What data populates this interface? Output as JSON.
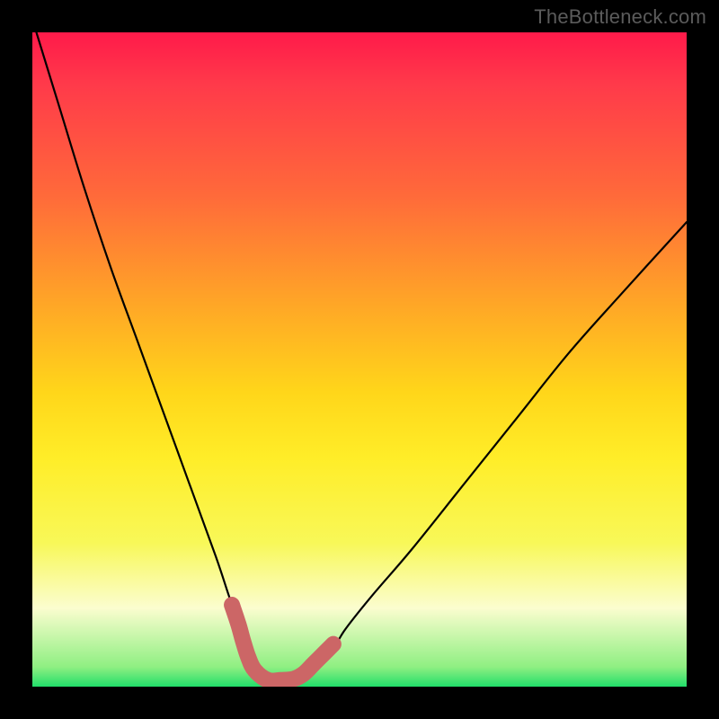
{
  "watermark": {
    "text": "TheBottleneck.com"
  },
  "chart_data": {
    "type": "line",
    "title": "",
    "xlabel": "",
    "ylabel": "",
    "xlim": [
      0,
      100
    ],
    "ylim": [
      0,
      100
    ],
    "series": [
      {
        "name": "bottleneck-curve",
        "x": [
          0,
          4,
          8,
          12,
          16,
          20,
          24,
          28,
          30,
          32,
          33,
          34,
          35,
          36,
          37,
          38,
          39,
          42,
          46,
          48,
          52,
          58,
          66,
          74,
          82,
          90,
          100
        ],
        "values": [
          102,
          89,
          76,
          64,
          53,
          42,
          31,
          20,
          14,
          8,
          5,
          3,
          2,
          1,
          1,
          1,
          1,
          1.5,
          6,
          9,
          14,
          21,
          31,
          41,
          51,
          60,
          71
        ]
      }
    ],
    "highlight": {
      "x": [
        30.5,
        31.5,
        32.2,
        33.0,
        34.0,
        36.0,
        38.0,
        40.0,
        41.5,
        43.0,
        44.5,
        46.0
      ],
      "values": [
        12.5,
        9.5,
        7.0,
        4.5,
        2.5,
        1.0,
        1.0,
        1.2,
        2.0,
        3.5,
        5.0,
        6.5
      ]
    },
    "gradient_stops": [
      {
        "pos": 0.0,
        "color": "#ff1a4a"
      },
      {
        "pos": 0.25,
        "color": "#ff6a3a"
      },
      {
        "pos": 0.55,
        "color": "#ffd61a"
      },
      {
        "pos": 0.78,
        "color": "#f8f858"
      },
      {
        "pos": 0.97,
        "color": "#8fef82"
      },
      {
        "pos": 1.0,
        "color": "#22de6a"
      }
    ]
  }
}
